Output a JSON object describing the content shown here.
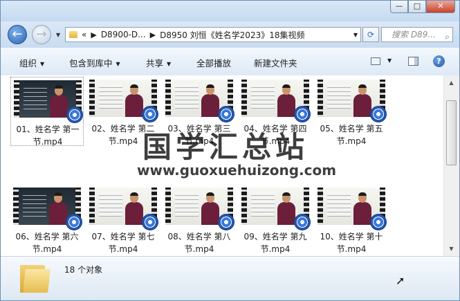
{
  "window": {
    "caption": {
      "minimize": "—",
      "maximize": "□",
      "close": "✕"
    }
  },
  "nav": {
    "back_icon": "arrow-left-icon",
    "forward_icon": "arrow-right-icon",
    "address": {
      "overflow": "«",
      "crumbs": [
        "D8900-D...",
        "D8950 刘恒《姓名学2023》18集视频"
      ]
    },
    "search_placeholder": "搜索 D89..."
  },
  "toolbar": {
    "organize": "组织",
    "include_library": "包含到库中",
    "share": "共享",
    "play_all": "全部播放",
    "new_folder": "新建文件夹"
  },
  "files": [
    {
      "line1": "01、姓名学 第一",
      "line2": "节.mp4",
      "board": "dark"
    },
    {
      "line1": "02、姓名学 第二",
      "line2": "节.mp4",
      "board": "light"
    },
    {
      "line1": "03、姓名学 第三",
      "line2": "节.mp4",
      "board": "light"
    },
    {
      "line1": "04、姓名学 第四",
      "line2": "节.mp4",
      "board": "light"
    },
    {
      "line1": "05、姓名学 第五",
      "line2": "节.mp4",
      "board": "light"
    },
    {
      "line1": "06、姓名学 第六",
      "line2": "节.mp4",
      "board": "dark"
    },
    {
      "line1": "07、姓名学 第七",
      "line2": "节.mp4",
      "board": "light"
    },
    {
      "line1": "08、姓名学 第八",
      "line2": "节.mp4",
      "board": "light"
    },
    {
      "line1": "09、姓名学 第九",
      "line2": "节.mp4",
      "board": "light"
    },
    {
      "line1": "10、姓名学 第十",
      "line2": "节.mp4",
      "board": "light"
    }
  ],
  "status": {
    "count": "18 个对象"
  },
  "watermark": {
    "title": "国学汇总站",
    "url": "www.guoxuehuizong.com"
  }
}
